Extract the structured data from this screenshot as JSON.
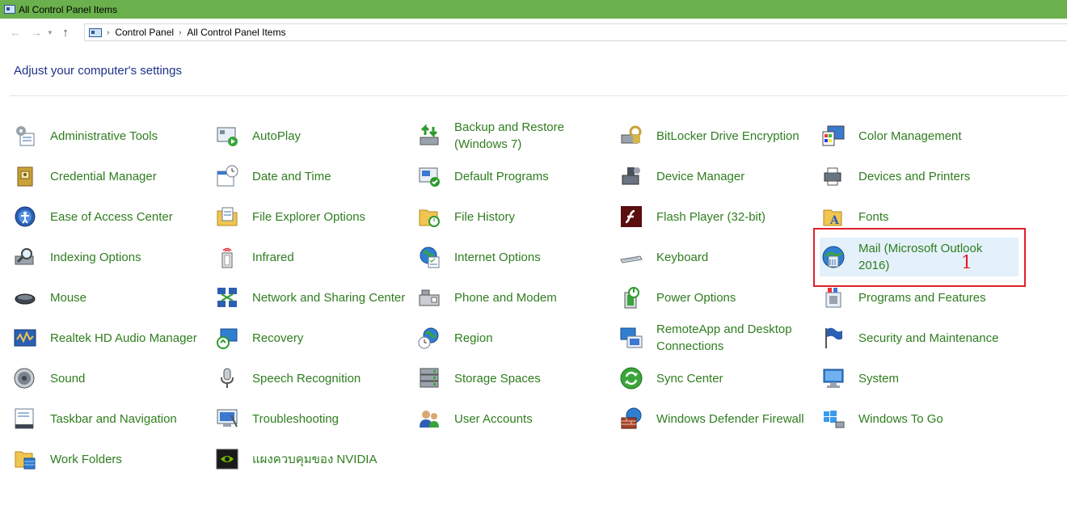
{
  "window": {
    "title": "All Control Panel Items"
  },
  "breadcrumb": [
    "Control Panel",
    "All Control Panel Items"
  ],
  "heading": "Adjust your computer's settings",
  "annotation": "1",
  "items": [
    {
      "label": "Administrative Tools",
      "icon": "admin-tools-icon"
    },
    {
      "label": "AutoPlay",
      "icon": "autoplay-icon"
    },
    {
      "label": "Backup and Restore (Windows 7)",
      "icon": "backup-restore-icon"
    },
    {
      "label": "BitLocker Drive Encryption",
      "icon": "bitlocker-icon"
    },
    {
      "label": "Color Management",
      "icon": "color-management-icon"
    },
    {
      "label": "Credential Manager",
      "icon": "credential-manager-icon"
    },
    {
      "label": "Date and Time",
      "icon": "date-time-icon"
    },
    {
      "label": "Default Programs",
      "icon": "default-programs-icon"
    },
    {
      "label": "Device Manager",
      "icon": "device-manager-icon"
    },
    {
      "label": "Devices and Printers",
      "icon": "devices-printers-icon"
    },
    {
      "label": "Ease of Access Center",
      "icon": "ease-of-access-icon"
    },
    {
      "label": "File Explorer Options",
      "icon": "file-explorer-options-icon"
    },
    {
      "label": "File History",
      "icon": "file-history-icon"
    },
    {
      "label": "Flash Player (32-bit)",
      "icon": "flash-player-icon"
    },
    {
      "label": "Fonts",
      "icon": "fonts-icon"
    },
    {
      "label": "Indexing Options",
      "icon": "indexing-options-icon"
    },
    {
      "label": "Infrared",
      "icon": "infrared-icon"
    },
    {
      "label": "Internet Options",
      "icon": "internet-options-icon"
    },
    {
      "label": "Keyboard",
      "icon": "keyboard-icon"
    },
    {
      "label": "Mail (Microsoft Outlook 2016)",
      "icon": "mail-icon",
      "selected": true
    },
    {
      "label": "Mouse",
      "icon": "mouse-icon"
    },
    {
      "label": "Network and Sharing Center",
      "icon": "network-sharing-icon"
    },
    {
      "label": "Phone and Modem",
      "icon": "phone-modem-icon"
    },
    {
      "label": "Power Options",
      "icon": "power-options-icon"
    },
    {
      "label": "Programs and Features",
      "icon": "programs-features-icon"
    },
    {
      "label": "Realtek HD Audio Manager",
      "icon": "realtek-audio-icon"
    },
    {
      "label": "Recovery",
      "icon": "recovery-icon"
    },
    {
      "label": "Region",
      "icon": "region-icon"
    },
    {
      "label": "RemoteApp and Desktop Connections",
      "icon": "remoteapp-icon"
    },
    {
      "label": "Security and Maintenance",
      "icon": "security-maintenance-icon"
    },
    {
      "label": "Sound",
      "icon": "sound-icon"
    },
    {
      "label": "Speech Recognition",
      "icon": "speech-recognition-icon"
    },
    {
      "label": "Storage Spaces",
      "icon": "storage-spaces-icon"
    },
    {
      "label": "Sync Center",
      "icon": "sync-center-icon"
    },
    {
      "label": "System",
      "icon": "system-icon"
    },
    {
      "label": "Taskbar and Navigation",
      "icon": "taskbar-navigation-icon"
    },
    {
      "label": "Troubleshooting",
      "icon": "troubleshooting-icon"
    },
    {
      "label": "User Accounts",
      "icon": "user-accounts-icon"
    },
    {
      "label": "Windows Defender Firewall",
      "icon": "firewall-icon"
    },
    {
      "label": "Windows To Go",
      "icon": "windows-to-go-icon"
    },
    {
      "label": "Work Folders",
      "icon": "work-folders-icon"
    },
    {
      "label": "แผงควบคุมของ NVIDIA",
      "icon": "nvidia-icon"
    }
  ]
}
